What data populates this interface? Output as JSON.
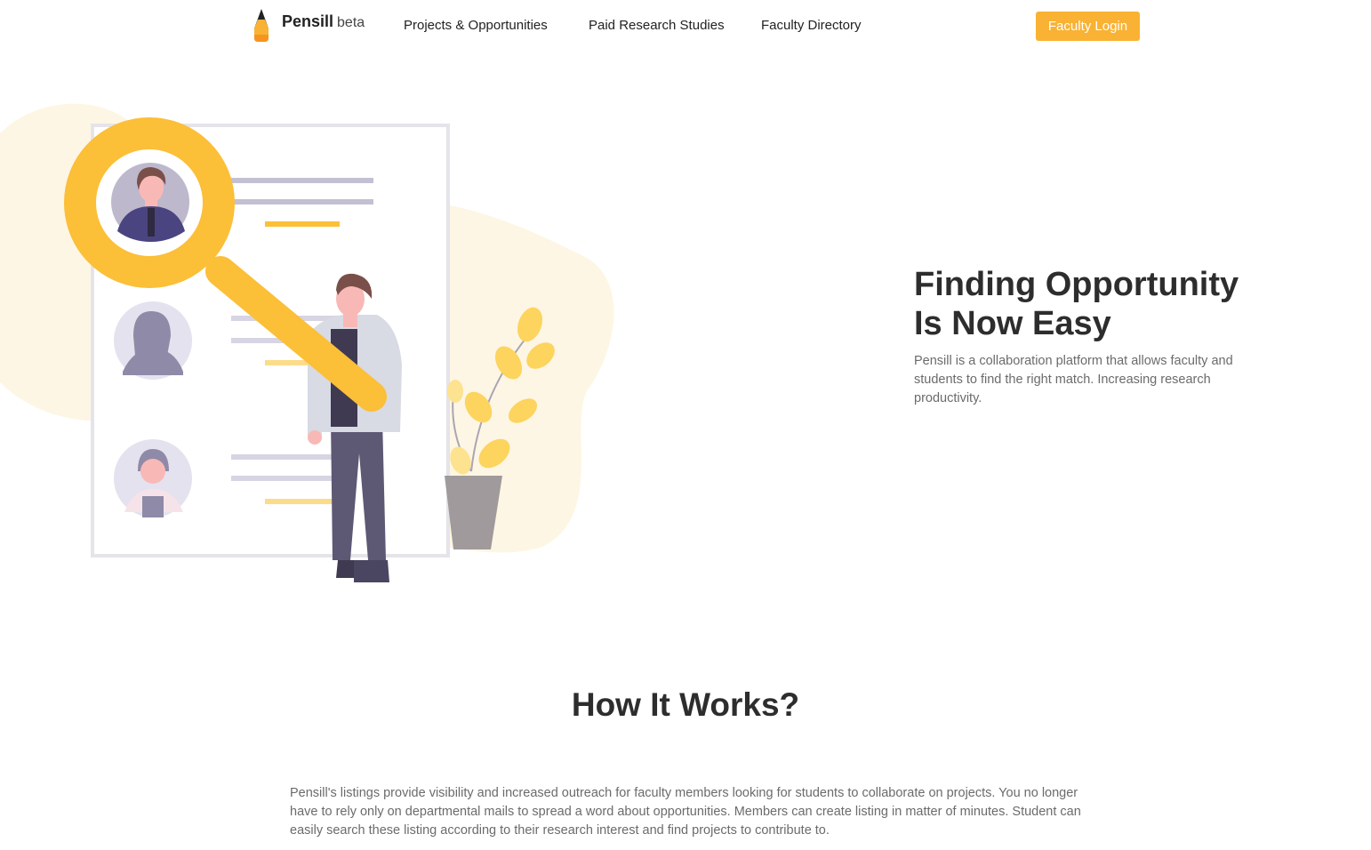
{
  "nav": {
    "brand": "Pensill",
    "brand_tag": "beta",
    "links": [
      "Projects & Opportunities",
      "Paid Research Studies",
      "Faculty Directory"
    ],
    "login_label": "Faculty Login"
  },
  "hero": {
    "title_line1": "Finding Opportunity",
    "title_line2": "Is Now Easy",
    "description": "Pensill is a collaboration platform that allows faculty and students to find the right match. Increasing research productivity."
  },
  "how": {
    "title": "How It Works?",
    "description": "Pensill's listings provide visibility and increased outreach for faculty members looking for students to collaborate on projects. You no longer have to rely only on departmental mails to spread a word about opportunities. Members can create listing in matter of minutes. Student can easily search these listing according to their research interest and find projects to contribute to."
  },
  "colors": {
    "accent": "#f9b233",
    "magnifier": "#fbbf38",
    "blob": "#fef6e4",
    "text_dark": "#2d2d2d",
    "text_muted": "#6b6b6b"
  },
  "icons": {
    "logo": "pencil-logo-icon"
  }
}
